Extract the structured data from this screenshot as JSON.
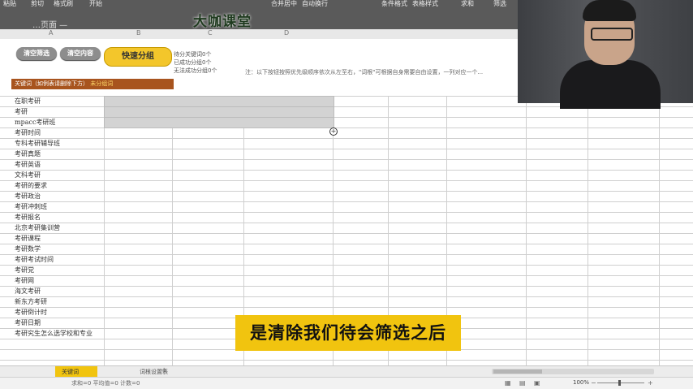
{
  "ribbon": {
    "items": [
      "粘贴",
      "剪切",
      "格式刷",
      "开始",
      "合并居中",
      "自动换行",
      "条件格式",
      "表格样式",
      "求和",
      "筛选"
    ],
    "brand": "大咖课堂",
    "title_fragment": "…页面 —"
  },
  "columns": [
    "A",
    "B",
    "C",
    "D"
  ],
  "buttons": {
    "clear_filter": "清空筛选",
    "clear_content": "清空内容",
    "quick_group": "快速分组"
  },
  "stats": [
    "待分关键词0个",
    "已成功分组0个",
    "无法成功分组0个"
  ],
  "note": "注：以下按钮按照优先级顺序依次从左至右，\"词根\"可根据自身需要自由设置，一列对应一个...",
  "keyword_header": {
    "label": "关键词（如例表请删除下方）",
    "accent": "未分组词"
  },
  "keywords": [
    "在职考研",
    "考研",
    "mpacc考研班",
    "考研时间",
    "专科考研辅导班",
    "考研真题",
    "考研英语",
    "文科考研",
    "考研的要求",
    "考研政治",
    "考研冲刺班",
    "考研报名",
    "北京考研集训营",
    "考研课程",
    "考研数学",
    "考研考试时间",
    "考研党",
    "考研网",
    "海文考研",
    "新东方考研",
    "考研倒计时",
    "考研日期",
    "考研究生怎么选学校和专业"
  ],
  "subtitle": "是清除我们待会筛选之后",
  "sheet_tabs": {
    "active": "关键词",
    "second": "词根设置表",
    "add_symbol": "+"
  },
  "status_bar": {
    "text": "求和=0  平均值=0  计数=0",
    "zoom": "100%"
  },
  "colors": {
    "accent_yellow": "#f1c40f",
    "header_brown": "#a8541e",
    "button_grey": "#8d8d8d"
  },
  "icons": [
    "plus-cursor-icon",
    "view-normal-icon",
    "view-layout-icon",
    "view-page-icon",
    "zoom-minus-icon",
    "zoom-plus-icon"
  ]
}
